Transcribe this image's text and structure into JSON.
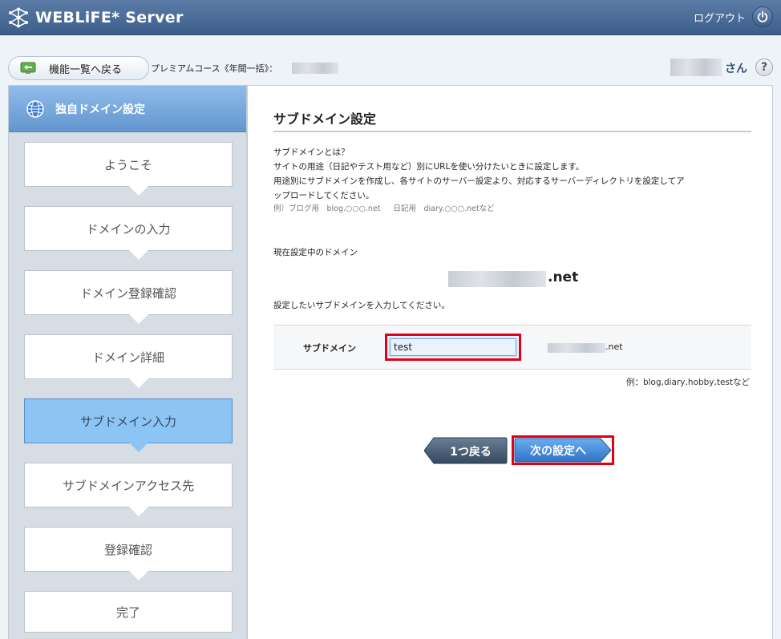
{
  "header": {
    "app_title": "WEBLiFE* Server",
    "logout_label": "ログアウト",
    "logo_icon": "network-star-icon",
    "power_icon": "power-icon"
  },
  "subbar": {
    "back_label": "機能一覧へ戻る",
    "course_label": "プレミアムコース《年間一括》：",
    "user_suffix": "さん",
    "help_label": "?"
  },
  "sidebar": {
    "title": "独自ドメイン設定",
    "steps": [
      {
        "label": "ようこそ",
        "active": false
      },
      {
        "label": "ドメインの入力",
        "active": false
      },
      {
        "label": "ドメイン登録確認",
        "active": false
      },
      {
        "label": "ドメイン詳細",
        "active": false
      },
      {
        "label": "サブドメイン入力",
        "active": true
      },
      {
        "label": "サブドメインアクセス先",
        "active": false
      },
      {
        "label": "登録確認",
        "active": false
      },
      {
        "label": "完了",
        "active": false
      }
    ]
  },
  "main": {
    "title": "サブドメイン設定",
    "desc_lines": [
      "サブドメインとは？",
      "サイトの用途（日記やテスト用など）別にURLを使い分けたいときに設定します。",
      "用途別にサブドメインを作成し、各サイトのサーバー設定より、対応するサーバーディレクトリを設定してア",
      "ップロードしてください。"
    ],
    "example_a": "例）ブログ用　blog.○○○.net",
    "example_b": "日記用　diary.○○○.netなど",
    "current_domain_label": "現在設定中のドメイン",
    "current_domain_suffix": ".net",
    "input_prompt": "設定したいサブドメインを入力してください。",
    "form_label": "サブドメイン",
    "input_value": "test",
    "domain_suffix": ".net",
    "example_note": "例：blog,diary,hobby,testなど",
    "back_button": "1つ戻る",
    "next_button": "次の設定へ"
  },
  "colors": {
    "header": "#4a6b98",
    "sidebar_head": "#7aa9dc",
    "active_step": "#8cc4f5",
    "highlight": "#e00018",
    "next_button": "#3f86d6",
    "back_button": "#3e556f"
  }
}
